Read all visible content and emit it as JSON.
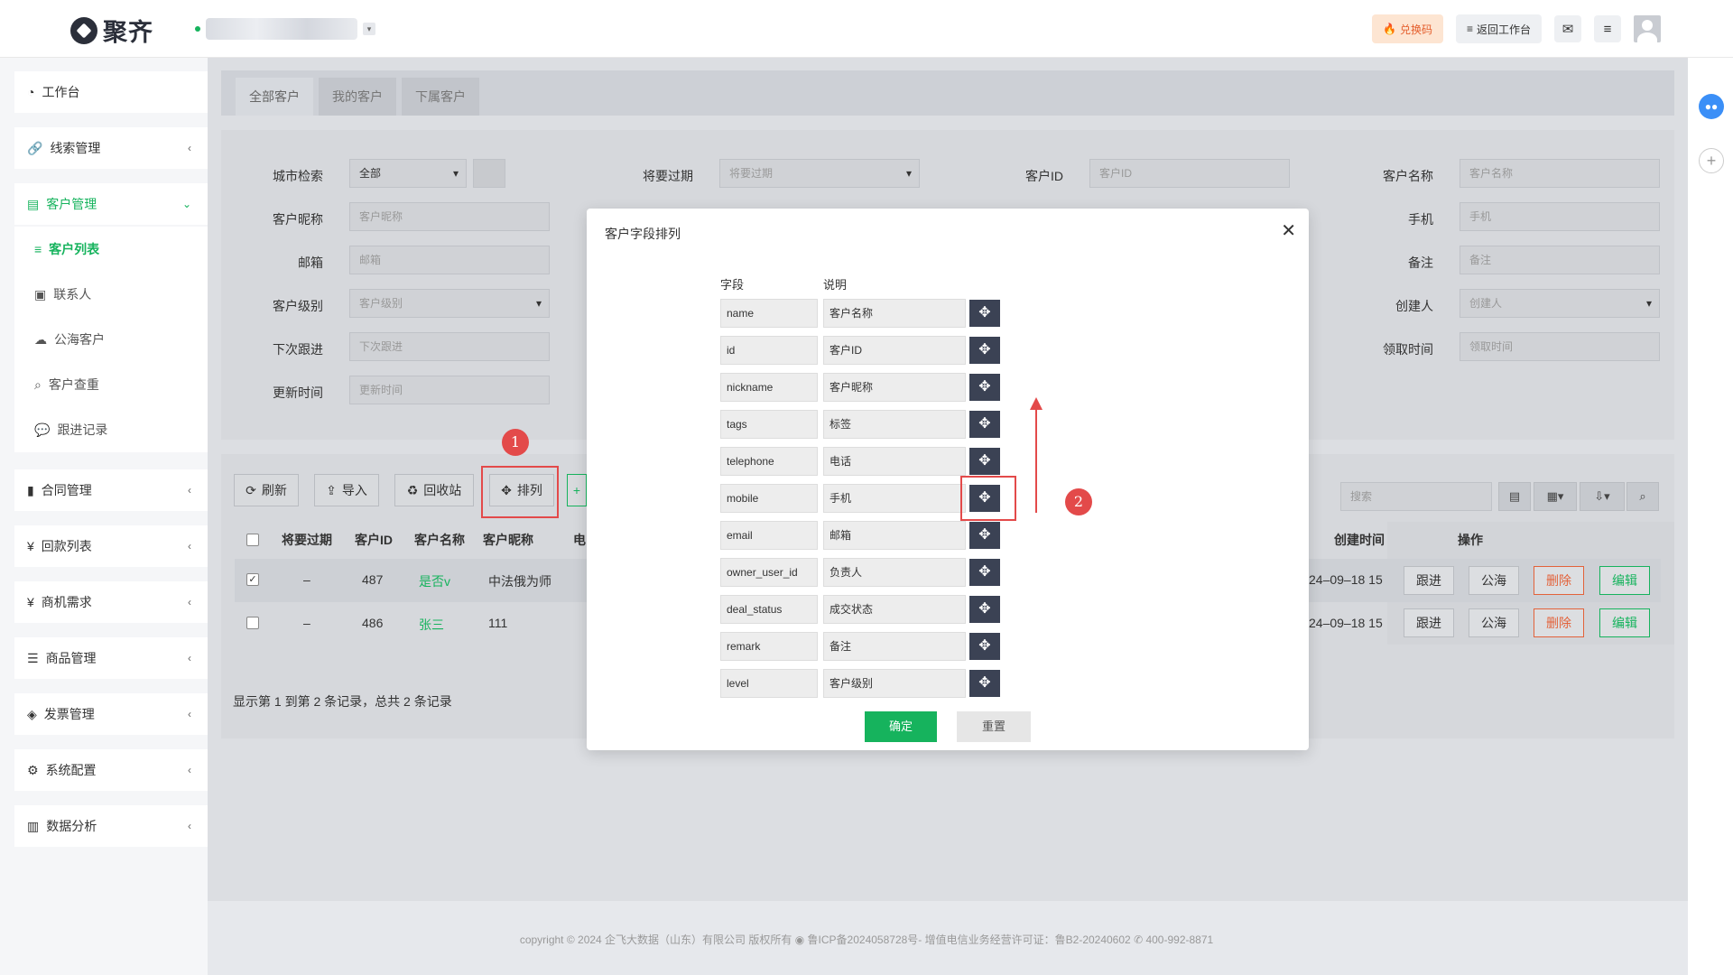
{
  "header": {
    "logo_text": "聚齐",
    "redeem_label": "兑换码",
    "back_label": "返回工作台"
  },
  "sidebar": {
    "items": [
      {
        "label": "工作台",
        "icon": "dashboard-icon"
      },
      {
        "label": "线索管理",
        "icon": "link-icon"
      },
      {
        "label": "客户管理",
        "icon": "card-icon"
      },
      {
        "label": "合同管理",
        "icon": "bookmark-icon"
      },
      {
        "label": "回款列表",
        "icon": "yen-icon"
      },
      {
        "label": "商机需求",
        "icon": "yen-icon"
      },
      {
        "label": "商品管理",
        "icon": "list-icon"
      },
      {
        "label": "发票管理",
        "icon": "tag-icon"
      },
      {
        "label": "系统配置",
        "icon": "gears-icon"
      },
      {
        "label": "数据分析",
        "icon": "bar-chart-icon"
      }
    ],
    "sub_items": [
      "客户列表",
      "联系人",
      "公海客户",
      "客户查重",
      "跟进记录"
    ]
  },
  "tabs": [
    "全部客户",
    "我的客户",
    "下属客户"
  ],
  "filters": {
    "city_label": "城市检索",
    "city_value": "全部",
    "expiring_label": "将要过期",
    "expiring_ph": "将要过期",
    "cid_label": "客户ID",
    "cid_ph": "客户ID",
    "cname_label": "客户名称",
    "cname_ph": "客户名称",
    "nick_label": "客户昵称",
    "nick_ph": "客户昵称",
    "mobile_label": "手机",
    "mobile_ph": "手机",
    "email_label": "邮箱",
    "email_ph": "邮箱",
    "remark_label": "备注",
    "remark_ph": "备注",
    "level_label": "客户级别",
    "level_ph": "客户级别",
    "creator_label": "创建人",
    "creator_ph": "创建人",
    "next_label": "下次跟进",
    "next_ph": "下次跟进",
    "claim_label": "领取时间",
    "claim_ph": "领取时间",
    "update_label": "更新时间",
    "update_ph": "更新时间"
  },
  "toolbar": {
    "refresh": "刷新",
    "import": "导入",
    "recycle": "回收站",
    "sort": "排列",
    "search_ph": "搜索"
  },
  "table": {
    "headers": [
      "将要过期",
      "客户ID",
      "客户名称",
      "客户昵称",
      "电",
      "创建时间",
      "操作"
    ],
    "rows": [
      {
        "expire": "–",
        "id": "487",
        "name": "是否v",
        "nick": "中法俄为师",
        "created": "24–09–18 15"
      },
      {
        "expire": "–",
        "id": "486",
        "name": "张三",
        "nick": "111",
        "created": "24–09–18 15"
      }
    ],
    "actions": {
      "follow": "跟进",
      "public": "公海",
      "delete": "删除",
      "edit": "编辑"
    },
    "summary": "显示第 1 到第 2 条记录，总共 2 条记录"
  },
  "modal": {
    "title": "客户字段排列",
    "col_field": "字段",
    "col_desc": "说明",
    "rows": [
      {
        "field": "name",
        "desc": "客户名称"
      },
      {
        "field": "id",
        "desc": "客户ID"
      },
      {
        "field": "nickname",
        "desc": "客户昵称"
      },
      {
        "field": "tags",
        "desc": "标签"
      },
      {
        "field": "telephone",
        "desc": "电话"
      },
      {
        "field": "mobile",
        "desc": "手机"
      },
      {
        "field": "email",
        "desc": "邮箱"
      },
      {
        "field": "owner_user_id",
        "desc": "负责人"
      },
      {
        "field": "deal_status",
        "desc": "成交状态"
      },
      {
        "field": "remark",
        "desc": "备注"
      },
      {
        "field": "level",
        "desc": "客户级别"
      }
    ],
    "confirm": "确定",
    "reset": "重置"
  },
  "annotations": {
    "badge1": "1",
    "badge2": "2"
  },
  "footer": {
    "copyright": "copyright © 2024 企飞大数据（山东）有限公司 版权所有",
    "icp": "鲁ICP备2024058728号-",
    "license": "增值电信业务经营许可证：鲁B2-20240602",
    "phone": "400-992-8871"
  },
  "colors": {
    "accent": "#16b35d",
    "highlight": "#e34a4a",
    "move_btn": "#3b4254"
  }
}
